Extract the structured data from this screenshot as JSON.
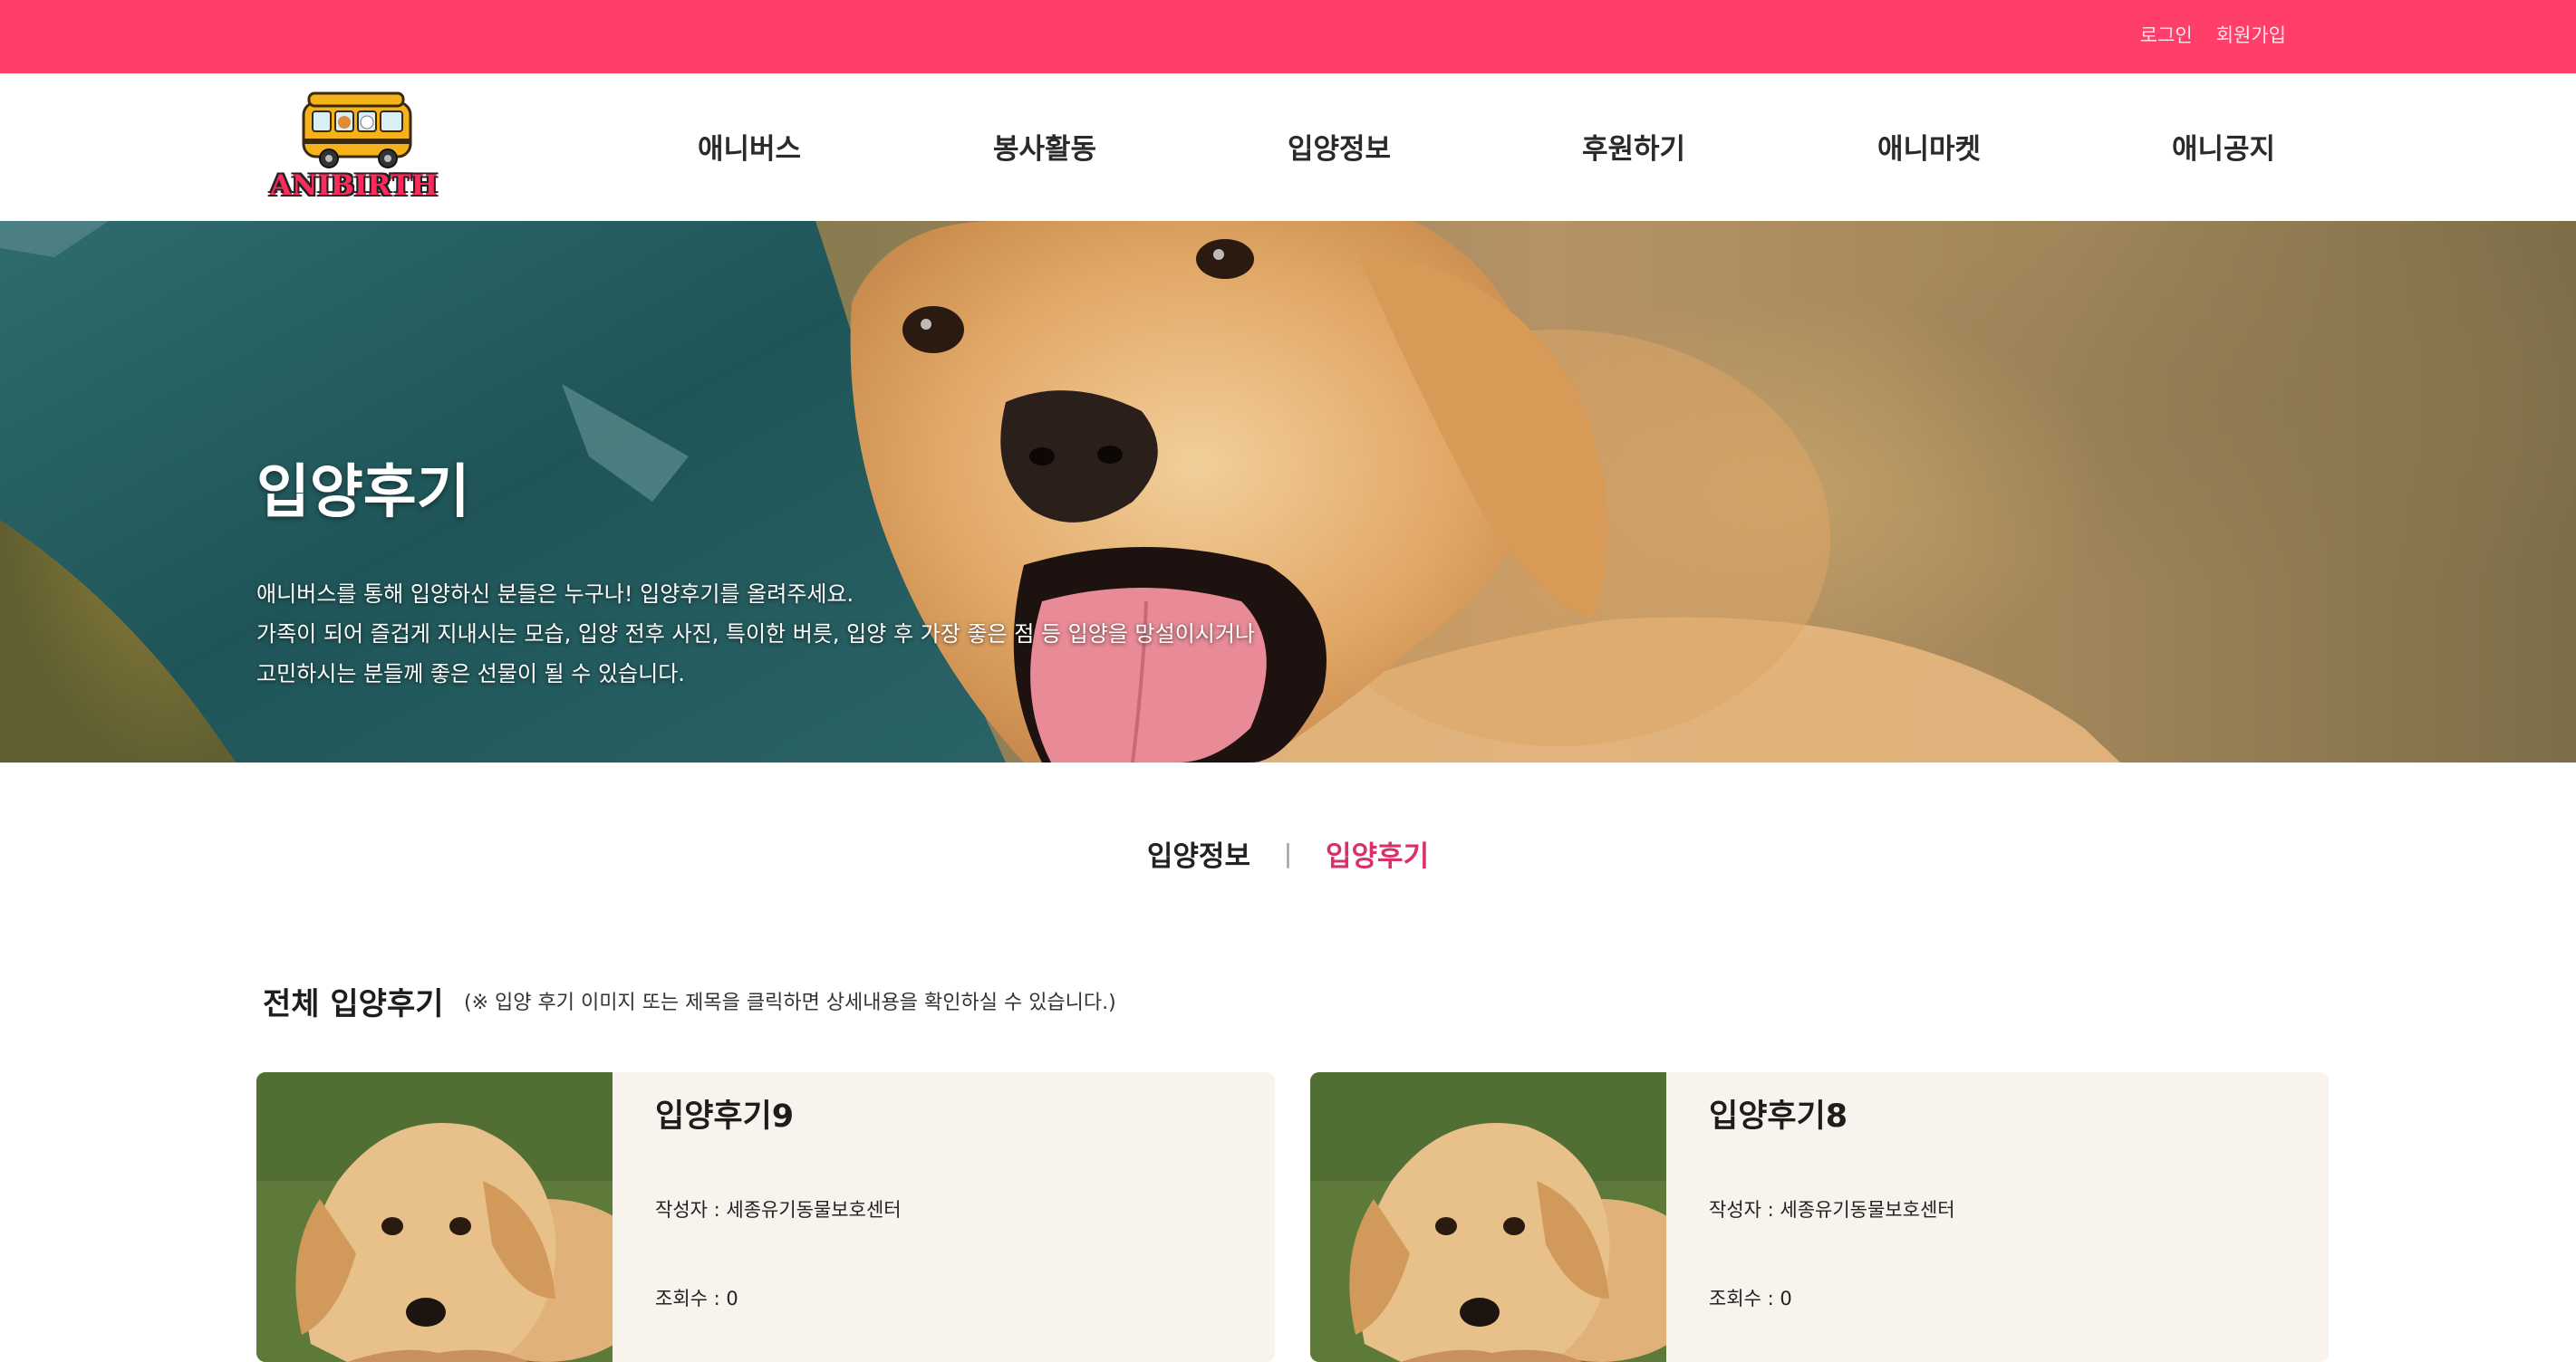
{
  "topbar": {
    "login": "로그인",
    "signup": "회원가입",
    "color": "#FF3F6A"
  },
  "logo": {
    "text": "ANIBIRTH"
  },
  "nav": [
    {
      "label": "애니버스"
    },
    {
      "label": "봉사활동"
    },
    {
      "label": "입양정보"
    },
    {
      "label": "후원하기"
    },
    {
      "label": "애니마켓"
    },
    {
      "label": "애니공지"
    }
  ],
  "hero": {
    "title": "입양후기",
    "desc_lines": [
      "애니버스를 통해 입양하신 분들은 누구나! 입양후기를 올려주세요.",
      "가족이 되어 즐겁게 지내시는 모습, 입양 전후 사진, 특이한 버릇, 입양 후 가장 좋은 점 등 입양을 망설이시거나",
      "고민하시는 분들께 좋은 선물이 될 수 있습니다."
    ]
  },
  "subtabs": {
    "info": "입양정보",
    "separator": "|",
    "review": "입양후기",
    "active_color": "#d8316a"
  },
  "section": {
    "title": "전체 입양후기",
    "note": "(※ 입양 후기 이미지 또는 제목을 클릭하면 상세내용을 확인하실 수 있습니다.)"
  },
  "cards": [
    {
      "title": "입양후기9",
      "author": "작성자 : 세종유기동물보호센터",
      "views": "조회수 : 0"
    },
    {
      "title": "입양후기8",
      "author": "작성자 : 세종유기동물보호센터",
      "views": "조회수 : 0"
    }
  ]
}
